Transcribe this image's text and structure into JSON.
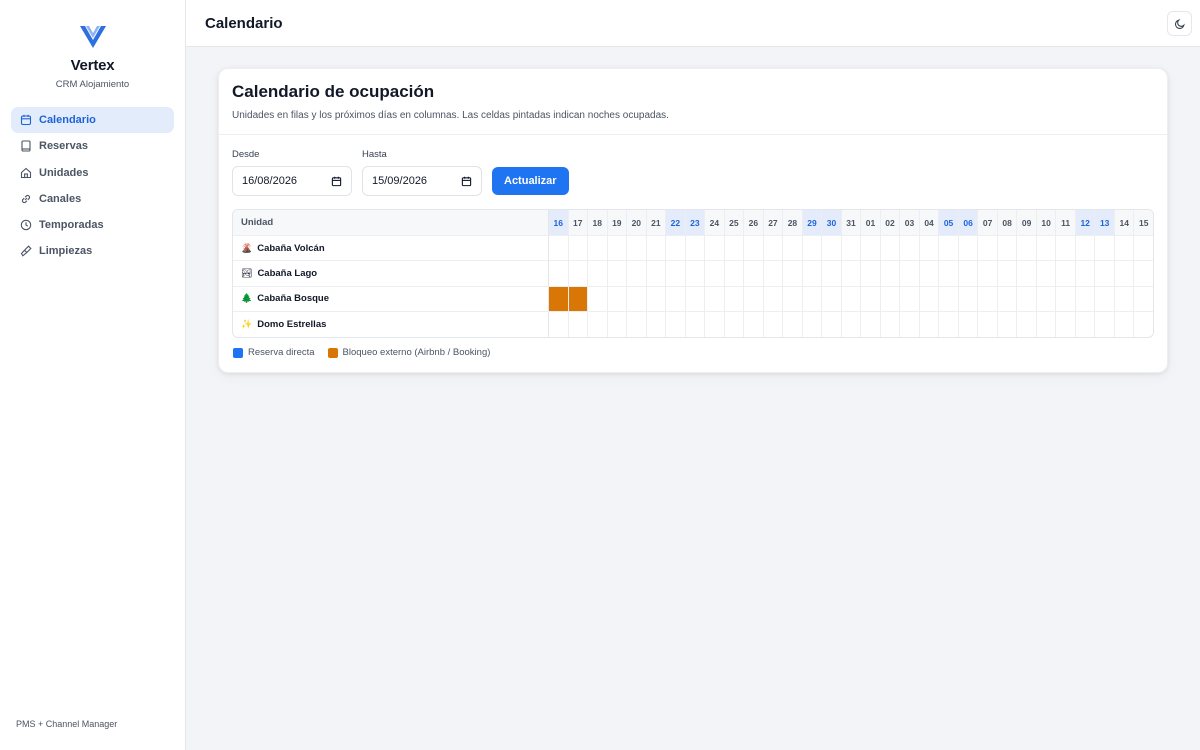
{
  "brand": {
    "name": "Vertex",
    "subtitle": "CRM Alojamiento",
    "logo_icon": "v-logo-icon",
    "color": "#2f6fe0"
  },
  "sidebar": {
    "items": [
      {
        "label": "Calendario",
        "icon": "calendar-icon",
        "active": true
      },
      {
        "label": "Reservas",
        "icon": "book-icon",
        "active": false
      },
      {
        "label": "Unidades",
        "icon": "home-icon",
        "active": false
      },
      {
        "label": "Canales",
        "icon": "link-icon",
        "active": false
      },
      {
        "label": "Temporadas",
        "icon": "clock-icon",
        "active": false
      },
      {
        "label": "Limpiezas",
        "icon": "brush-icon",
        "active": false
      }
    ],
    "footer": "PMS + Channel Manager"
  },
  "topbar": {
    "title": "Calendario",
    "theme_icon": "moon-icon"
  },
  "card": {
    "title": "Calendario de ocupación",
    "description": "Unidades en filas y los próximos días en columnas. Las celdas pintadas indican noches ocupadas."
  },
  "filters": {
    "from_label": "Desde",
    "from_value": "16/08/2026",
    "to_label": "Hasta",
    "to_value": "15/09/2026",
    "update_label": "Actualizar"
  },
  "calendar": {
    "unit_header": "Unidad",
    "days": [
      {
        "label": "16",
        "weekend": true
      },
      {
        "label": "17",
        "weekend": false
      },
      {
        "label": "18",
        "weekend": false
      },
      {
        "label": "19",
        "weekend": false
      },
      {
        "label": "20",
        "weekend": false
      },
      {
        "label": "21",
        "weekend": false
      },
      {
        "label": "22",
        "weekend": true
      },
      {
        "label": "23",
        "weekend": true
      },
      {
        "label": "24",
        "weekend": false
      },
      {
        "label": "25",
        "weekend": false
      },
      {
        "label": "26",
        "weekend": false
      },
      {
        "label": "27",
        "weekend": false
      },
      {
        "label": "28",
        "weekend": false
      },
      {
        "label": "29",
        "weekend": true
      },
      {
        "label": "30",
        "weekend": true
      },
      {
        "label": "31",
        "weekend": false
      },
      {
        "label": "01",
        "weekend": false
      },
      {
        "label": "02",
        "weekend": false
      },
      {
        "label": "03",
        "weekend": false
      },
      {
        "label": "04",
        "weekend": false
      },
      {
        "label": "05",
        "weekend": true
      },
      {
        "label": "06",
        "weekend": true
      },
      {
        "label": "07",
        "weekend": false
      },
      {
        "label": "08",
        "weekend": false
      },
      {
        "label": "09",
        "weekend": false
      },
      {
        "label": "10",
        "weekend": false
      },
      {
        "label": "11",
        "weekend": false
      },
      {
        "label": "12",
        "weekend": true
      },
      {
        "label": "13",
        "weekend": true
      },
      {
        "label": "14",
        "weekend": false
      },
      {
        "label": "15",
        "weekend": false
      }
    ],
    "units": [
      {
        "emoji": "🌋",
        "name": "Cabaña Volcán",
        "occupied": []
      },
      {
        "emoji": "🏞",
        "name": "Cabaña Lago",
        "occupied": []
      },
      {
        "emoji": "🌲",
        "name": "Cabaña Bosque",
        "occupied": [
          {
            "day": "16",
            "type": "blocked"
          },
          {
            "day": "17",
            "type": "blocked"
          }
        ]
      },
      {
        "emoji": "✨",
        "name": "Domo Estrellas",
        "occupied": []
      }
    ]
  },
  "legend": {
    "items": [
      {
        "label": "Reserva directa",
        "color": "#1f74f2"
      },
      {
        "label": "Bloqueo externo (Airbnb / Booking)",
        "color": "#d97706"
      }
    ]
  }
}
